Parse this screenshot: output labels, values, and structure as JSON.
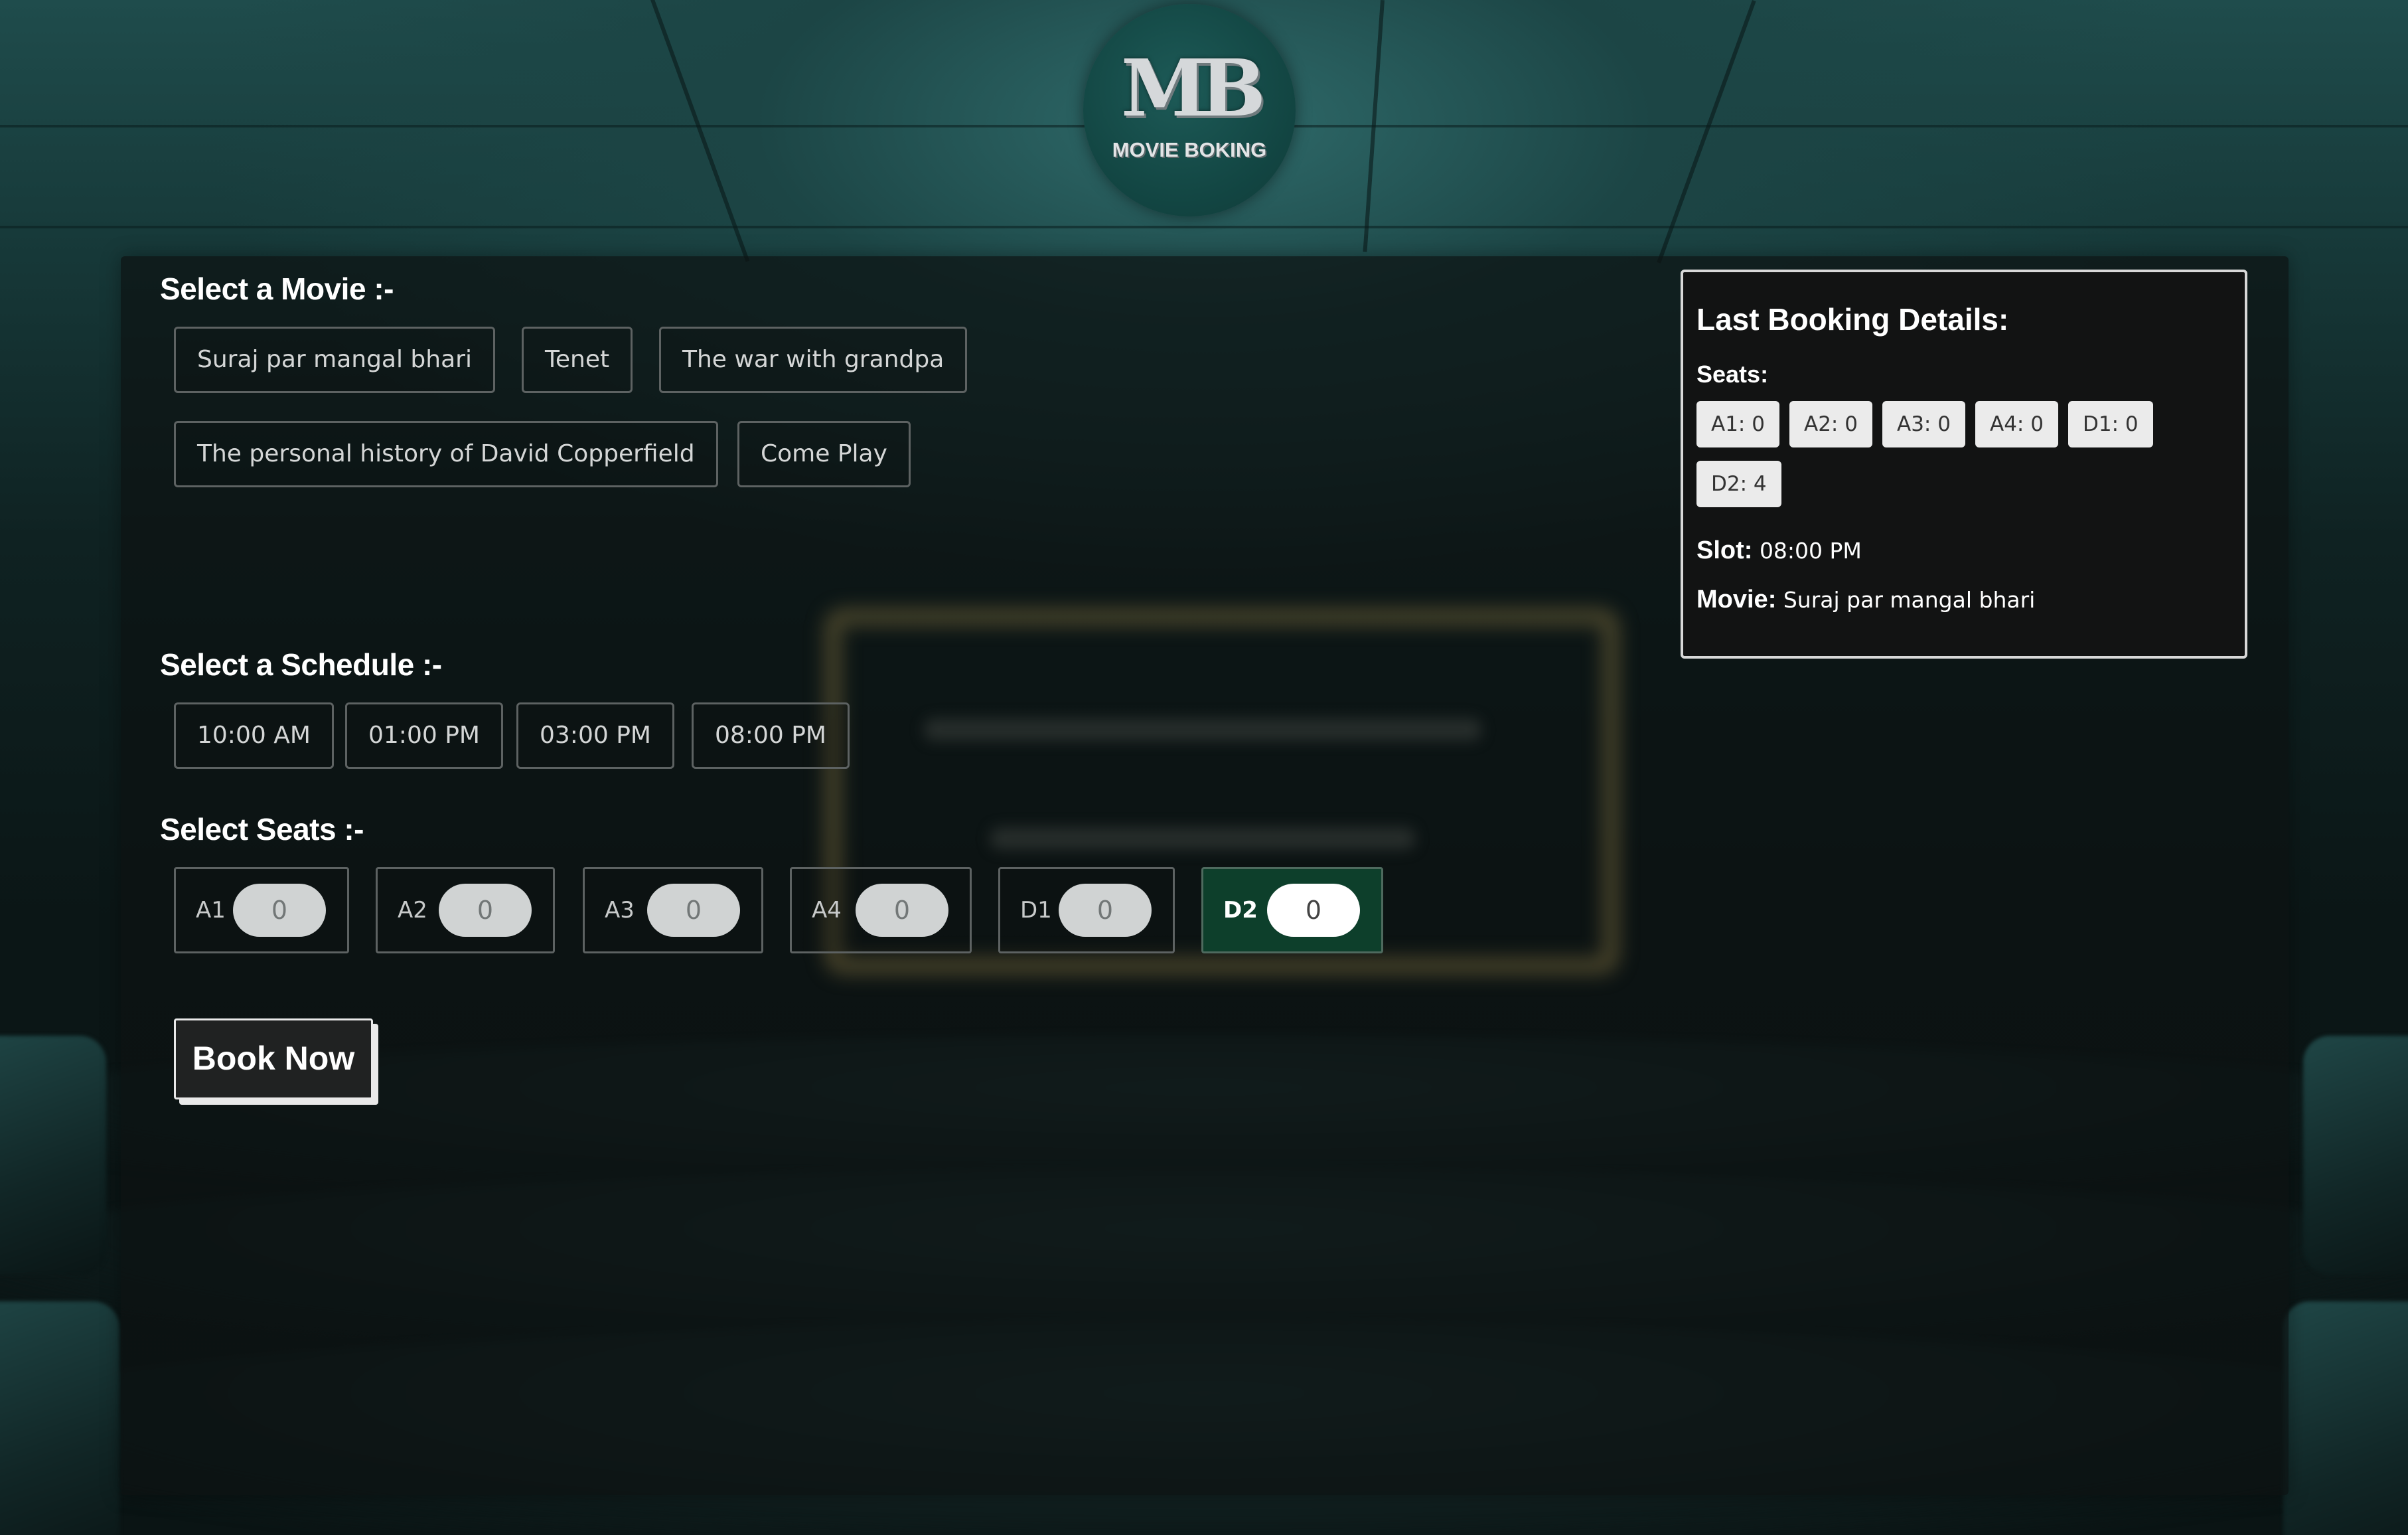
{
  "logo": {
    "mark": "MB",
    "text": "MOVIE BOKING"
  },
  "movies": {
    "title": "Select a Movie :-",
    "items": [
      "Suraj par mangal bhari",
      "Tenet",
      "The war with grandpa",
      "The personal history of David Copperfield",
      "Come Play"
    ]
  },
  "schedule": {
    "title": "Select a Schedule :-",
    "slots": [
      "10:00 AM",
      "01:00 PM",
      "03:00 PM",
      "08:00 PM"
    ]
  },
  "seats": {
    "title": "Select Seats :-",
    "items": [
      {
        "label": "A1",
        "count": "0",
        "selected": false
      },
      {
        "label": "A2",
        "count": "0",
        "selected": false
      },
      {
        "label": "A3",
        "count": "0",
        "selected": false
      },
      {
        "label": "A4",
        "count": "0",
        "selected": false
      },
      {
        "label": "D1",
        "count": "0",
        "selected": false
      },
      {
        "label": "D2",
        "count": "0",
        "selected": true
      }
    ]
  },
  "book_button": "Book Now",
  "last_booking": {
    "title": "Last Booking Details:",
    "seats_label": "Seats:",
    "seats": [
      "A1: 0",
      "A2: 0",
      "A3: 0",
      "A4: 0",
      "D1: 0",
      "D2: 4"
    ],
    "slot_label": "Slot:",
    "slot_value": "08:00 PM",
    "movie_label": "Movie:",
    "movie_value": "Suraj par mangal bhari"
  },
  "colors": {
    "selected_seat": "#0d3f2b",
    "logo_circle": "#134744",
    "panel": "#0c1212",
    "card": "#121313"
  }
}
